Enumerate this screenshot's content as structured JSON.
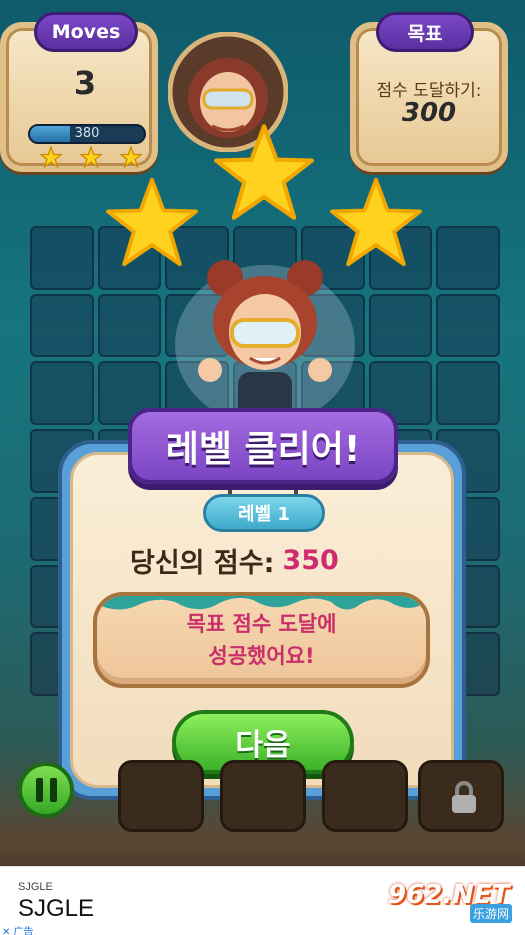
{
  "hud": {
    "moves_label": "Moves",
    "moves_value": "3",
    "score_progress_text": "380",
    "score_progress_fraction": 0.35,
    "stars_earned": 3,
    "goal_tab": "목표",
    "goal_label": "점수 도달하기:",
    "goal_value": "300"
  },
  "result": {
    "banner": "레벨 클리어!",
    "level": "레벨 1",
    "score_label": "당신의 점수:",
    "score_value": "350",
    "message_line1": "목표 점수 도달에",
    "message_line2": "성공했어요!",
    "next_button": "다음",
    "stars": 3
  },
  "controls": {
    "pause_icon": "pause-icon",
    "locked_slot_icon": "lock-icon"
  },
  "ad": {
    "brand_small": "SJGLE",
    "brand_big": "SJGLE",
    "ad_tag": "✕ 广告"
  },
  "watermark": {
    "main": "962.NET",
    "sub": "乐游网"
  },
  "colors": {
    "banner_purple": "#7b45c3",
    "score_pink": "#cf2c6e",
    "next_green": "#3cb12a",
    "star_yellow": "#ffd21f"
  }
}
